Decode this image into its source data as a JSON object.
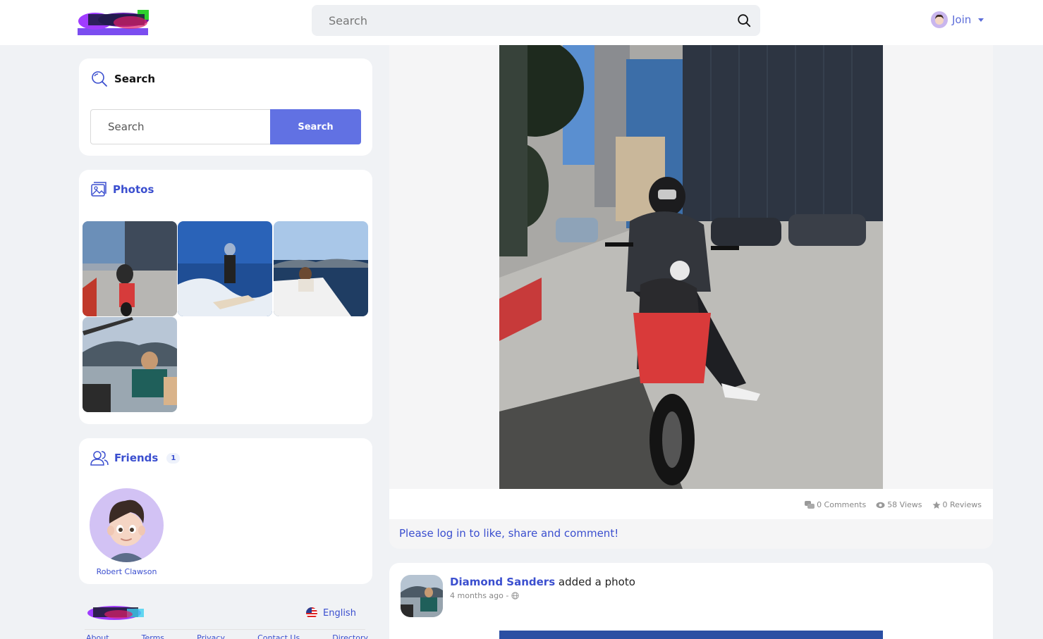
{
  "header": {
    "search_placeholder": "Search",
    "join_label": "Join"
  },
  "search_widget": {
    "title": "Search",
    "input_placeholder": "Search",
    "button_label": "Search"
  },
  "photos_widget": {
    "title": "Photos",
    "photos": [
      {
        "icon": "scooter-rider-photo"
      },
      {
        "icon": "wakesurf-photo"
      },
      {
        "icon": "boat-sea-photo"
      },
      {
        "icon": "boat-passenger-photo"
      }
    ]
  },
  "friends_widget": {
    "title": "Friends",
    "count": "1",
    "friends": [
      {
        "name": "Robert Clawson"
      }
    ]
  },
  "footer": {
    "language": "English",
    "links": [
      "About",
      "Terms",
      "Privacy",
      "Contact Us",
      "Directory"
    ]
  },
  "post1": {
    "stats": {
      "comments": "0 Comments",
      "views": "58 Views",
      "reviews": "0 Reviews"
    },
    "login_prompt": "Please log in to like, share and comment!"
  },
  "post2": {
    "author": "Diamond Sanders",
    "action": "added a photo",
    "time": "4 months ago -"
  },
  "colors": {
    "accent": "#3b4fcf",
    "button": "#6171e3",
    "background": "#f0f2f5"
  }
}
